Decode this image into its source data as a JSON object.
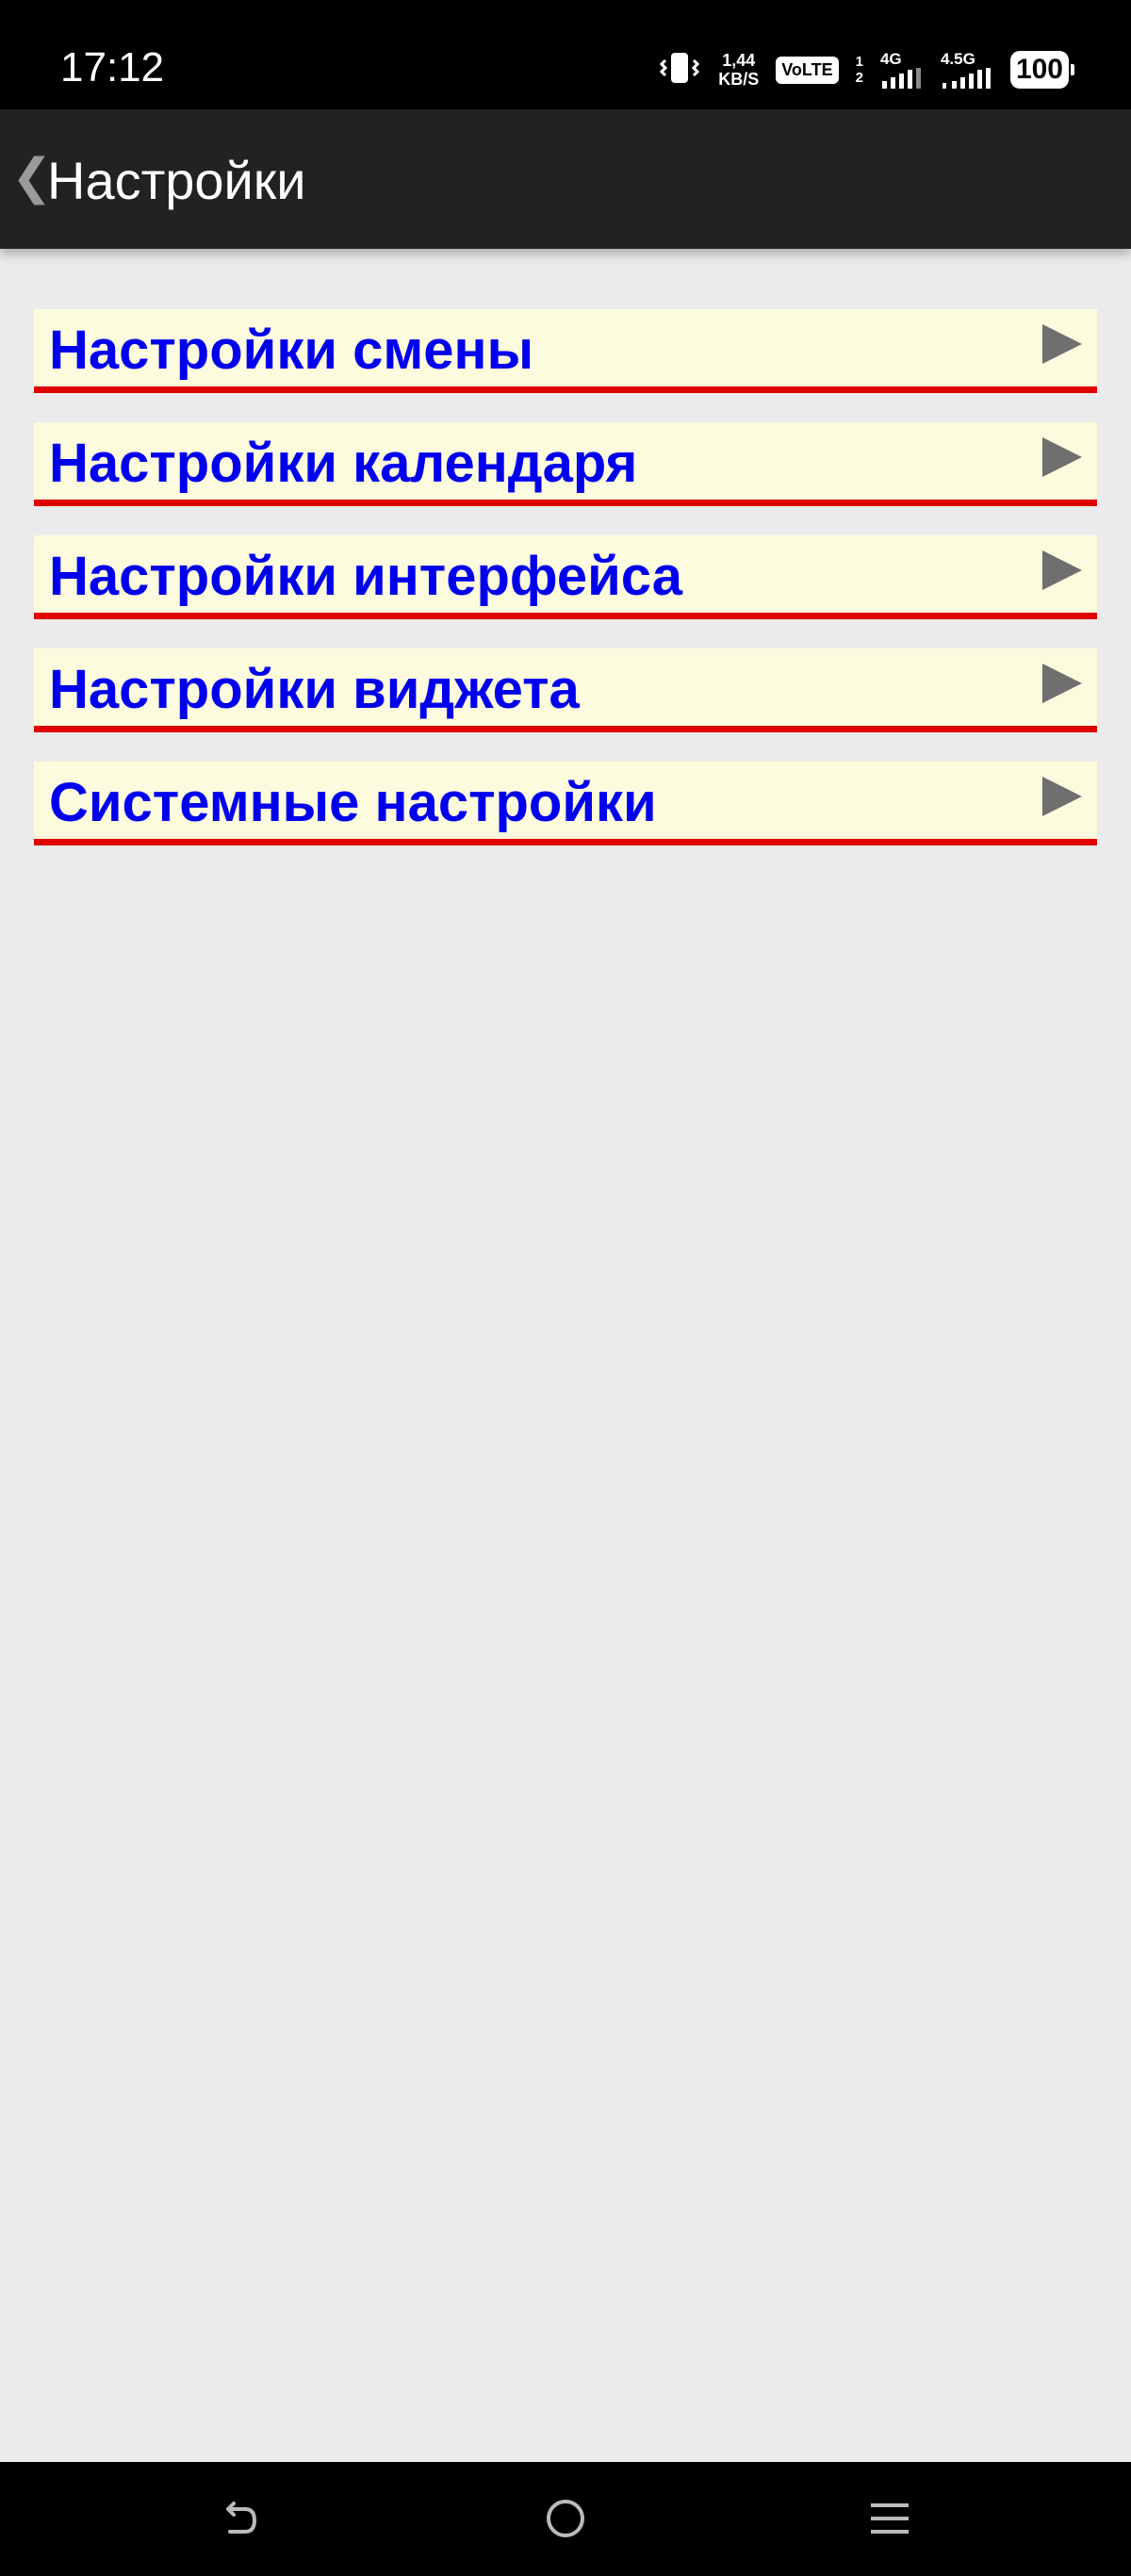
{
  "status_bar": {
    "time": "17:12",
    "net_speed_value": "1,44",
    "net_speed_unit": "KB/S",
    "volte": "VoLTE",
    "sim_1": "1",
    "sim_2": "2",
    "net_type_1": "4G",
    "net_type_2": "4.5G",
    "battery": "100"
  },
  "app_bar": {
    "back_glyph": "❮",
    "title": "Настройки"
  },
  "menu": {
    "items": [
      {
        "label": "Настройки смены",
        "icon": "play-arrow-icon"
      },
      {
        "label": "Настройки календаря",
        "icon": "play-arrow-icon"
      },
      {
        "label": "Настройки интерфейса",
        "icon": "play-arrow-icon"
      },
      {
        "label": "Настройки виджета",
        "icon": "play-arrow-icon"
      },
      {
        "label": "Системные настройки",
        "icon": "play-arrow-icon"
      }
    ]
  },
  "colors": {
    "item_background": "#fdfbdd",
    "item_text": "#0000ee",
    "item_underline": "#e00000",
    "arrow": "#6f6f6f",
    "app_bar": "#222222",
    "page_background": "#ebebeb"
  },
  "nav_bar": {
    "back_icon": "back-icon",
    "home_icon": "home-circle-icon",
    "menu_icon": "recents-menu-icon"
  }
}
